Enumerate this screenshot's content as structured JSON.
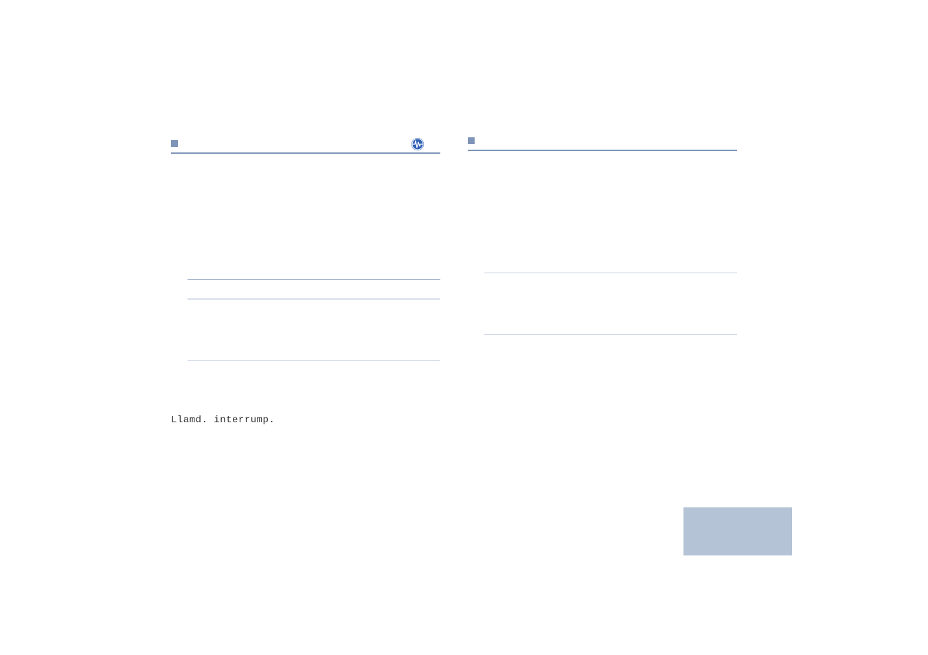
{
  "status_text": "Llamd. interrump.",
  "colors": {
    "accent": "#7e94b9",
    "light_rule": "#c5cede",
    "footer_block": "#b4c3d6",
    "icon_blue": "#2f5fb6"
  }
}
